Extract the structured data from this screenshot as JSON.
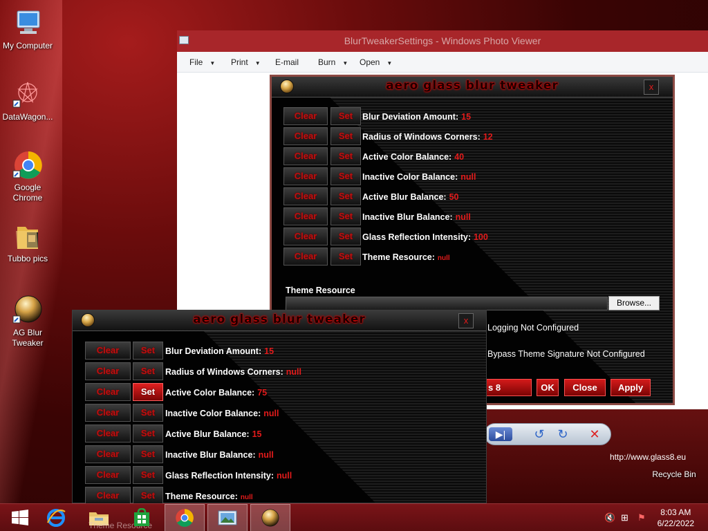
{
  "desktop": {
    "icons": [
      {
        "label": "My Computer",
        "icon": "computer-icon"
      },
      {
        "label": "DataWagon...",
        "icon": "datawagon-icon"
      },
      {
        "label": "Google Chrome",
        "icon": "chrome-icon"
      },
      {
        "label": "Tubbo pics",
        "icon": "folder-icon"
      },
      {
        "label": "AG Blur Tweaker",
        "icon": "ag-blur-tweaker-icon"
      },
      {
        "label": "Recycle Bin",
        "icon": "recycle-bin-icon"
      }
    ]
  },
  "photo_viewer": {
    "title": "BlurTweakerSettings - Windows Photo Viewer",
    "menu": [
      "File",
      "Print",
      "E-mail",
      "Burn",
      "Open"
    ],
    "url_fragment": "http://www.glass8.eu",
    "toolbar_icons": [
      "next-icon",
      "rotate-left-icon",
      "rotate-right-icon",
      "delete-icon"
    ]
  },
  "tweaker_back": {
    "title": "aero glass blur tweaker",
    "close": "x",
    "clear_label": "Clear",
    "set_label": "Set",
    "rows": [
      {
        "label": "Blur Deviation Amount:",
        "value": "15"
      },
      {
        "label": "Radius of Windows Corners:",
        "value": "12"
      },
      {
        "label": "Active Color Balance:",
        "value": "40"
      },
      {
        "label": "Inactive Color Balance:",
        "value": "null"
      },
      {
        "label": "Active Blur Balance:",
        "value": "50"
      },
      {
        "label": "Inactive Blur Balance:",
        "value": "null"
      },
      {
        "label": "Glass Reflection Intensity:",
        "value": "100"
      },
      {
        "label": "Theme Resource:",
        "value": "null"
      }
    ],
    "theme_resource_label": "Theme Resource",
    "browse_label": "Browse...",
    "logging": "Logging Not Configured",
    "bypass": "Bypass Theme Signature Not Configured",
    "bottom_buttons": {
      "partial": "s 8",
      "ok": "OK",
      "close": "Close",
      "apply": "Apply"
    }
  },
  "tweaker_front": {
    "title": "aero glass blur tweaker",
    "close": "x",
    "clear_label": "Clear",
    "set_label": "Set",
    "rows": [
      {
        "label": "Blur Deviation Amount:",
        "value": "15"
      },
      {
        "label": "Radius of Windows Corners:",
        "value": "null"
      },
      {
        "label": "Active Color Balance:",
        "value": "75"
      },
      {
        "label": "Inactive Color Balance:",
        "value": "null"
      },
      {
        "label": "Active Blur Balance:",
        "value": "15"
      },
      {
        "label": "Inactive Blur Balance:",
        "value": "null"
      },
      {
        "label": "Glass Reflection Intensity:",
        "value": "null"
      },
      {
        "label": "Theme Resource:",
        "value": "null"
      }
    ]
  },
  "taskbar": {
    "items": [
      "start-icon",
      "internet-explorer-icon",
      "file-explorer-icon",
      "store-icon",
      "chrome-icon",
      "photo-viewer-icon",
      "ag-blur-tweaker-icon"
    ],
    "overlap_text": "Theme Resource",
    "time": "8:03 AM",
    "date": "6/22/2022",
    "tray_icons": [
      "volume-muted-icon",
      "network-icon",
      "action-center-icon"
    ]
  }
}
